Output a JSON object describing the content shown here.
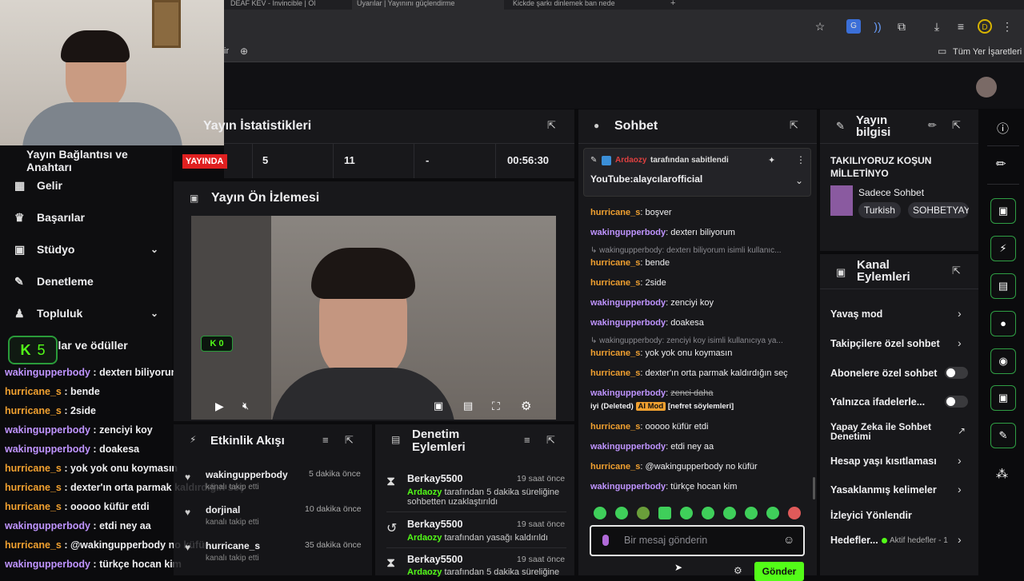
{
  "browser": {
    "tabs": [
      "DEAF KEV - Invincible | Ol",
      "Uyarılar | Yayınını güçlendirme",
      "Kickde şarkı dinlemek ban nede"
    ],
    "bookmarks_folder": "Tüm Yer İşaretleri",
    "bookmark_fragment": "ir"
  },
  "webcam_badge": "5",
  "sidebar": {
    "heading": "Yayın Bağlantısı ve Anahtarı",
    "items": [
      {
        "label": "Gelir",
        "icon": "dashboard-icon"
      },
      {
        "label": "Başarılar",
        "icon": "trophy-icon"
      },
      {
        "label": "Stüdyo",
        "icon": "studio-icon"
      },
      {
        "label": "Denetleme",
        "icon": "wrench-icon"
      },
      {
        "label": "Topluluk",
        "icon": "user-icon"
      },
      {
        "label": "plar ve ödüller",
        "icon": "gift-icon"
      }
    ]
  },
  "overlay_chat": [
    {
      "user": "wakingupperbody",
      "msg": "dexterı biliyorum",
      "color": "#bf94ff"
    },
    {
      "user": "hurricane_s",
      "msg": "bende",
      "color": "#f0a030"
    },
    {
      "user": "hurricane_s",
      "msg": "2side",
      "color": "#f0a030"
    },
    {
      "user": "wakingupperbody",
      "msg": "zenciyi koy",
      "color": "#bf94ff"
    },
    {
      "user": "wakingupperbody",
      "msg": "doakesa",
      "color": "#bf94ff"
    },
    {
      "user": "hurricane_s",
      "msg": "yok yok onu koymasın",
      "color": "#f0a030"
    },
    {
      "user": "hurricane_s",
      "msg": "dexter'ın orta parmak kaldırdığın seç",
      "color": "#f0a030"
    },
    {
      "user": "hurricane_s",
      "msg": "ooooo küfür etdi",
      "color": "#f0a030"
    },
    {
      "user": "wakingupperbody",
      "msg": "etdi ney aa",
      "color": "#bf94ff"
    },
    {
      "user": "hurricane_s",
      "msg": "@wakingupperbody no küfür",
      "color": "#f0a030"
    },
    {
      "user": "wakingupperbody",
      "msg": "türkçe hocan kim",
      "color": "#bf94ff"
    }
  ],
  "stats": {
    "title": "Yayın İstatistikleri",
    "live_badge": "YAYINDA",
    "viewers": "5",
    "followers": "11",
    "subs": "-",
    "duration": "00:56:30"
  },
  "preview": {
    "title": "Yayın Ön İzlemesi",
    "badge": "0"
  },
  "activity": {
    "title": "Etkinlik Akışı",
    "items": [
      {
        "user": "wakingupperbody",
        "sub": "kanalı takip etti",
        "time": "5 dakika önce"
      },
      {
        "user": "dorjinal",
        "sub": "kanalı takip etti",
        "time": "10 dakika önce"
      },
      {
        "user": "hurricane_s",
        "sub": "kanalı takip etti",
        "time": "35 dakika önce"
      }
    ]
  },
  "moderation": {
    "title": "Denetim Eylemleri",
    "items": [
      {
        "user": "Berkay5500",
        "time": "19 saat önce",
        "mod": "Ardaozy",
        "text": "tarafından 5 dakika süreliğine",
        "text2": "sohbetten uzaklaştırıldı"
      },
      {
        "user": "Berkay5500",
        "time": "19 saat önce",
        "mod": "Ardaozy",
        "text": "tarafından yasağı kaldırıldı",
        "text2": ""
      },
      {
        "user": "Berkay5500",
        "time": "19 saat önce",
        "mod": "Ardaozy",
        "text": "tarafından 5 dakika süreliğine",
        "text2": ""
      }
    ]
  },
  "chat": {
    "title": "Sohbet",
    "pinned_by": "Ardaozy",
    "pinned_label": "tarafından sabitlendi",
    "pinned_text": "YouTube:alaycılarofficial",
    "messages": [
      {
        "type": "msg",
        "user": "hurricane_s",
        "text": "boşver",
        "color": "#f0a030"
      },
      {
        "type": "msg",
        "user": "wakingupperbody",
        "text": "dexterı biliyorum",
        "color": "#bf94ff"
      },
      {
        "type": "reply",
        "text": "wakingupperbody: dexterı biliyorum isimli kullanıc..."
      },
      {
        "type": "msg",
        "user": "hurricane_s",
        "text": "bende",
        "color": "#f0a030"
      },
      {
        "type": "msg",
        "user": "hurricane_s",
        "text": "2side",
        "color": "#f0a030"
      },
      {
        "type": "msg",
        "user": "wakingupperbody",
        "text": "zenciyi koy",
        "color": "#bf94ff"
      },
      {
        "type": "msg",
        "user": "wakingupperbody",
        "text": "doakesa",
        "color": "#bf94ff"
      },
      {
        "type": "reply",
        "text": "wakingupperbody: zenciyi koy isimli kullanıcıya ya..."
      },
      {
        "type": "msg",
        "user": "hurricane_s",
        "text": "yok yok onu koymasın",
        "color": "#f0a030"
      },
      {
        "type": "msg",
        "user": "hurricane_s",
        "text": "dexter'ın orta parmak kaldırdığın seç",
        "color": "#f0a030"
      },
      {
        "type": "deleted",
        "user": "wakingupperbody",
        "text": "zenci daha",
        "color": "#bf94ff",
        "note1": "iyi (Deleted)",
        "tag": "AI Mod",
        "note2": "[nefret söylemleri]"
      },
      {
        "type": "msg",
        "user": "hurricane_s",
        "text": "ooooo küfür etdi",
        "color": "#f0a030"
      },
      {
        "type": "msg",
        "user": "wakingupperbody",
        "text": "etdi ney aa",
        "color": "#bf94ff"
      },
      {
        "type": "msg",
        "user": "hurricane_s",
        "text": "@wakingupperbody no küfür",
        "color": "#f0a030"
      },
      {
        "type": "msg",
        "user": "wakingupperbody",
        "text": "türkçe hocan kim",
        "color": "#bf94ff"
      }
    ],
    "input_placeholder": "Bir mesaj gönderin",
    "send_label": "Gönder"
  },
  "stream_info": {
    "title": "Yayın bilgisi",
    "stream_title": "TAKILIYORUZ KOŞUN MİLLETİNYO",
    "category": "Sadece Sohbet",
    "tags": [
      "Turkish",
      "SOHBETYAY"
    ]
  },
  "channel_actions": {
    "title": "Kanal Eylemleri",
    "items": [
      {
        "label": "Yavaş mod",
        "control": "arrow"
      },
      {
        "label": "Takipçilere özel sohbet",
        "control": "arrow"
      },
      {
        "label": "Abonelere özel sohbet",
        "control": "toggle"
      },
      {
        "label": "Yalnızca ifadelerle...",
        "control": "toggle"
      },
      {
        "label": "Yapay Zeka ile Sohbet Denetimi",
        "control": "external"
      },
      {
        "label": "Hesap yaşı kısıtlaması",
        "control": "arrow"
      },
      {
        "label": "Yasaklanmış kelimeler",
        "control": "arrow"
      },
      {
        "label": "İzleyici Yönlendir",
        "control": "none"
      },
      {
        "label": "Hedefler...",
        "control": "arrow",
        "extra": "Aktif hedefler - 1"
      }
    ]
  },
  "colors": {
    "accent": "#53fc18",
    "live": "#e02020",
    "purple": "#bf94ff",
    "orange": "#f0a030"
  }
}
